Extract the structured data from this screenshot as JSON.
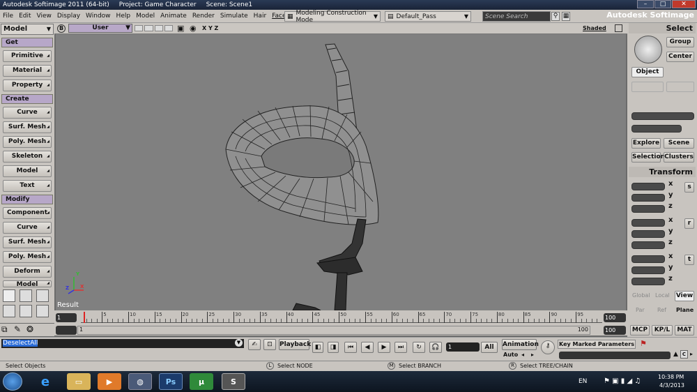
{
  "window": {
    "title": "Autodesk Softimage 2011 (64-bit)",
    "project": "Project: Game Character",
    "scene": "Scene: Scene1"
  },
  "menu": {
    "items": [
      "File",
      "Edit",
      "View",
      "Display",
      "Window",
      "Help",
      "Model",
      "Animate",
      "Render",
      "Simulate",
      "Hair",
      "Face Robot"
    ],
    "construction_mode": "Modeling Construction Mode",
    "pass": "Default_Pass",
    "scene_search_placeholder": "Scene Search",
    "brand": "Autodesk Softimage"
  },
  "left_panel": {
    "mode": "Model",
    "sections": [
      {
        "title": "Get",
        "buttons": [
          "Primitive",
          "Material",
          "Property"
        ]
      },
      {
        "title": "Create",
        "buttons": [
          "Curve",
          "Surf. Mesh",
          "Poly. Mesh",
          "Skeleton",
          "Model",
          "Text"
        ]
      },
      {
        "title": "Modify",
        "buttons": [
          "Component",
          "Curve",
          "Surf. Mesh",
          "Poly. Mesh",
          "Deform",
          "Model"
        ]
      }
    ]
  },
  "viewport": {
    "camera": "User",
    "axes": "X Y Z",
    "shading": "Shaded",
    "label": "Result",
    "axis_x": "X",
    "axis_y": "Y",
    "axis_z": "Z"
  },
  "right_panel": {
    "select_title": "Select",
    "group": "Group",
    "center": "Center",
    "object": "Object",
    "explore": "Explore",
    "scene": "Scene",
    "selection": "Selection",
    "clusters": "Clusters",
    "transform_title": "Transform",
    "axes": [
      "x",
      "y",
      "z"
    ],
    "scale": "s",
    "rotate": "r",
    "translate": "t",
    "global": "Global",
    "local": "Local",
    "view": "View",
    "par": "Par",
    "ref": "Ref",
    "plane": "Plane",
    "mcp": "MCP",
    "kpl": "KP/L",
    "mat": "MAT"
  },
  "timeline": {
    "start": "1",
    "end": "100",
    "current": "1",
    "range_end": "100",
    "range_end2": "100",
    "ticks": [
      "5",
      "10",
      "15",
      "20",
      "25",
      "30",
      "35",
      "40",
      "45",
      "50",
      "55",
      "60",
      "65",
      "70",
      "75",
      "80",
      "85",
      "90",
      "95"
    ]
  },
  "command": {
    "field_value": "DeselectAll",
    "playback": "Playback",
    "frame": "1",
    "all": "All",
    "animation": "Animation",
    "auto": "Auto",
    "key_marked": "Key Marked Parameters"
  },
  "status": {
    "message": "Select Objects",
    "l_key": "L",
    "l_text": "Select NODE",
    "m_key": "M",
    "m_text": "Select BRANCH",
    "r_key": "R",
    "r_text": "Select TREE/CHAIN"
  },
  "taskbar": {
    "lang": "EN",
    "time": "10:38 PM",
    "date": "4/3/2013",
    "apps": [
      "Internet Explorer",
      "File Explorer",
      "Media Player",
      "Firefox",
      "Photoshop",
      "uTorrent",
      "Softimage"
    ],
    "ps_label": "Ps"
  }
}
